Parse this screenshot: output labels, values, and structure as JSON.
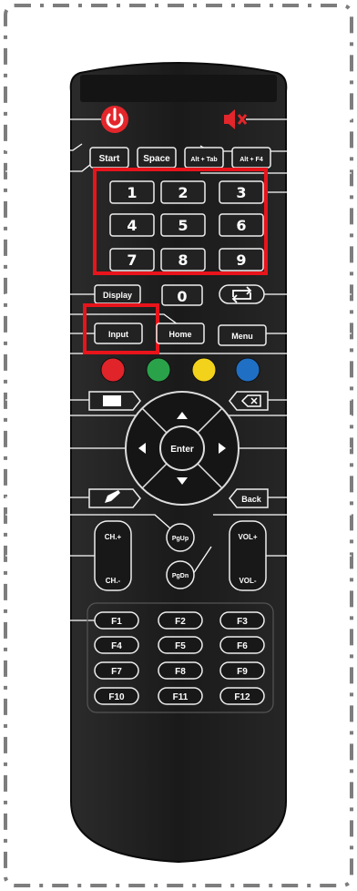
{
  "remote": {
    "buttons": {
      "start": "Start",
      "space": "Space",
      "alt_tab": "Alt + Tab",
      "alt_f4": "Alt + F4",
      "display": "Display",
      "zero": "0",
      "input": "Input",
      "home": "Home",
      "menu": "Menu",
      "enter": "Enter",
      "back": "Back",
      "pgup": "PgUp",
      "pgdn": "PgDn",
      "ch_plus": "CH.+",
      "ch_minus": "CH.-",
      "vol_plus": "VOL+",
      "vol_minus": "VOL-"
    },
    "numpad": [
      "1",
      "2",
      "3",
      "4",
      "5",
      "6",
      "7",
      "8",
      "9"
    ],
    "function_keys": [
      "F1",
      "F2",
      "F3",
      "F4",
      "F5",
      "F6",
      "F7",
      "F8",
      "F9",
      "F10",
      "F11",
      "F12"
    ],
    "color_keys": [
      "#e0242a",
      "#2aa24a",
      "#f2d21b",
      "#1f6fc4"
    ],
    "colors": {
      "body": "#1c1c1c",
      "highlight": "#e8141b",
      "power": "#e3262b",
      "mute": "#e3262b",
      "frame": "#7a7a7a"
    },
    "icons": [
      "power-icon",
      "mute-icon",
      "repeat-icon",
      "screen-icon",
      "delete-icon",
      "annotation-pen-icon",
      "arrow-up-icon",
      "arrow-down-icon",
      "arrow-left-icon",
      "arrow-right-icon"
    ]
  }
}
